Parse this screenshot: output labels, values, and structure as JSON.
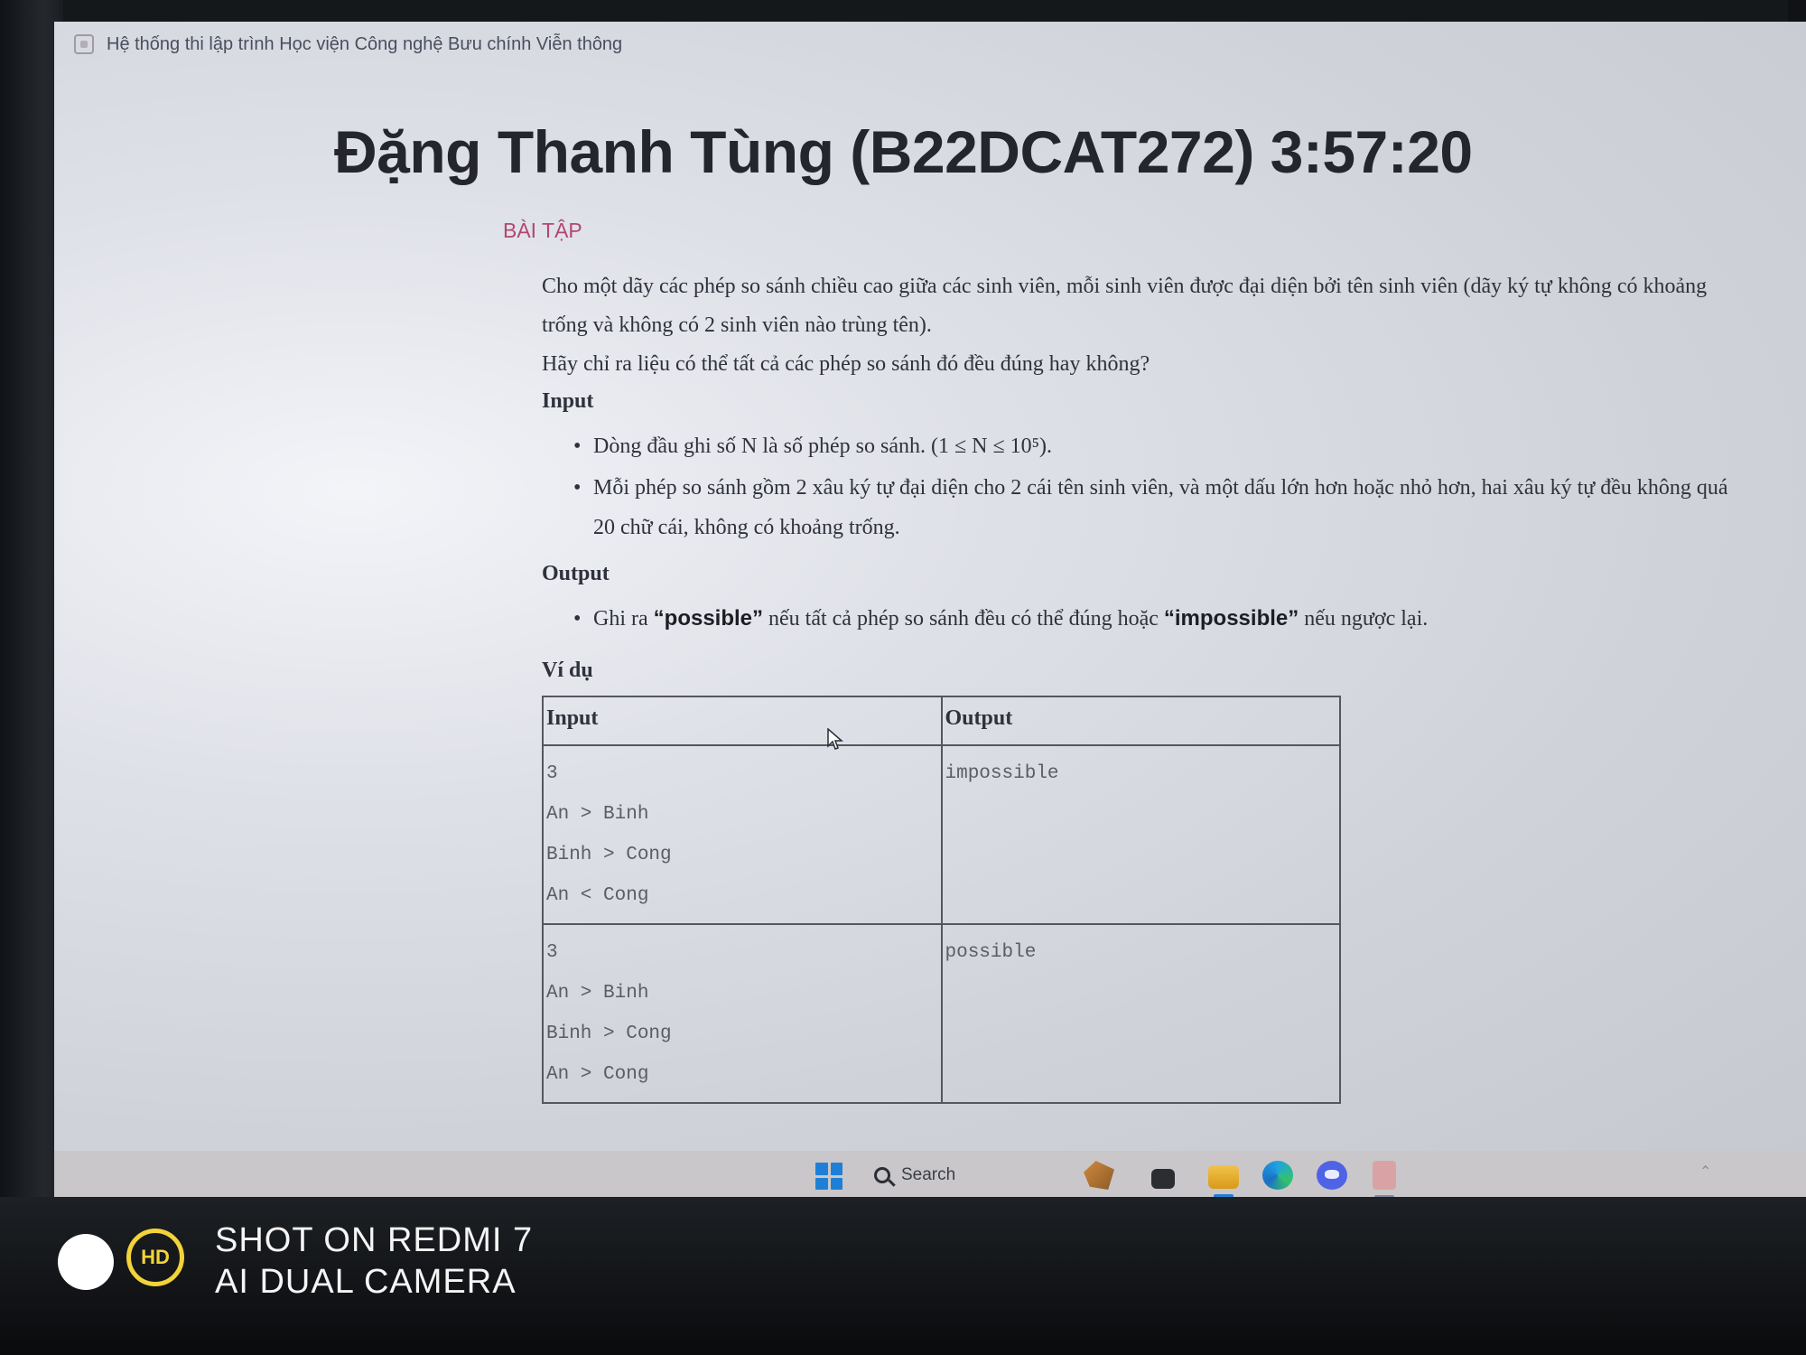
{
  "window": {
    "title": "Hệ thống thi lập trình Học viện Công nghệ Bưu chính Viễn thông"
  },
  "header": {
    "student_and_timer": "Đặng Thanh Tùng (B22DCAT272) 3:57:20"
  },
  "section_label": "BÀI TẬP",
  "problem": {
    "paragraphs": [
      "Cho một dãy các phép so sánh chiều cao giữa các sinh viên, mỗi sinh viên được đại diện bởi tên sinh viên (dãy ký tự không có khoảng trống và không có 2 sinh viên nào trùng tên).",
      "Hãy chỉ ra liệu có thể tất cả các phép so sánh đó đều đúng hay không?"
    ],
    "input_heading": "Input",
    "input_items": [
      "Dòng đầu ghi số N là số phép so sánh. (1 ≤ N ≤ 10⁵).",
      "Mỗi phép so sánh gồm 2 xâu ký tự đại diện cho 2 cái tên sinh viên, và một dấu lớn hơn hoặc nhỏ hơn, hai xâu ký tự đều không quá 20 chữ cái, không có khoảng trống."
    ],
    "output_heading": "Output",
    "output_item": {
      "prefix": "Ghi ra ",
      "possible": "“possible”",
      "middle": " nếu tất cả phép so sánh đều có thể đúng hoặc ",
      "impossible": "“impossible”",
      "suffix": " nếu ngược lại."
    },
    "example_heading": "Ví dụ",
    "example_table": {
      "headers": [
        "Input",
        "Output"
      ],
      "rows": [
        {
          "input": [
            "3",
            "An > Binh",
            "Binh > Cong",
            "An < Cong"
          ],
          "output": "impossible"
        },
        {
          "input": [
            "3",
            "An > Binh",
            "Binh > Cong",
            "An > Cong"
          ],
          "output": "possible"
        }
      ]
    }
  },
  "taskbar": {
    "search_label": "Search"
  },
  "watermark": {
    "badge": "HD",
    "line1": "SHOT ON REDMI 7",
    "line2": "AI DUAL CAMERA"
  }
}
